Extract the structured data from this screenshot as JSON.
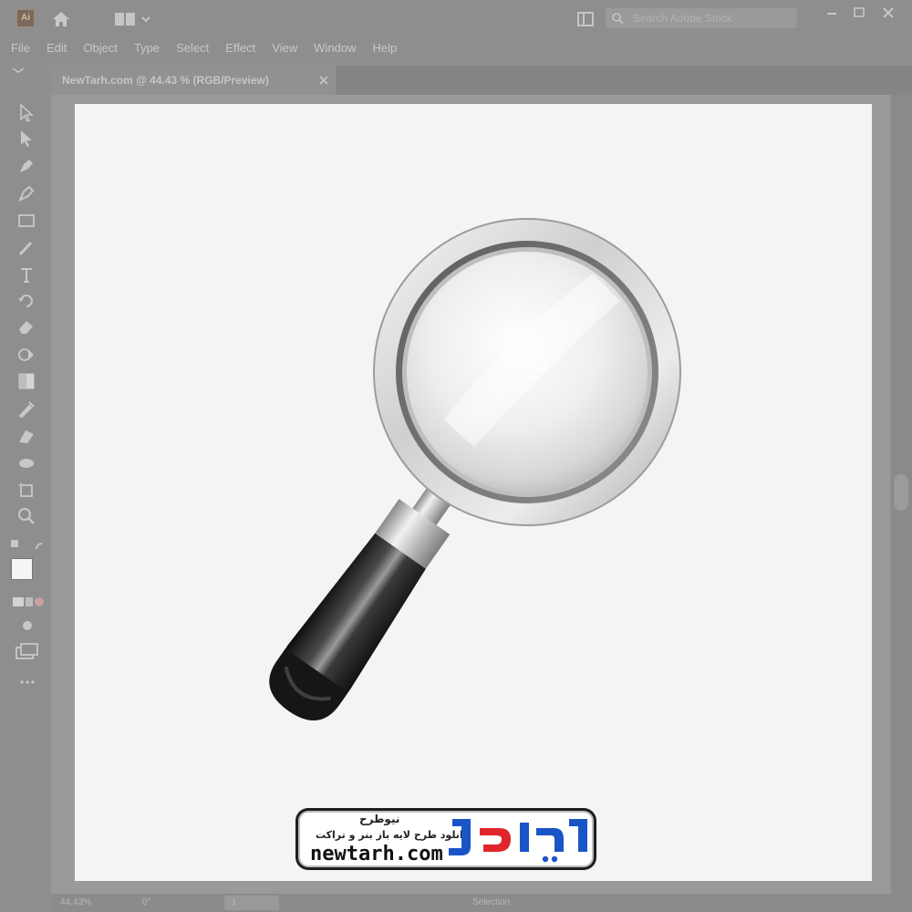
{
  "app": {
    "logo_text": "Ai",
    "search_placeholder": "Search Adobe Stock"
  },
  "menu": [
    "File",
    "Edit",
    "Object",
    "Type",
    "Select",
    "Effect",
    "View",
    "Window",
    "Help"
  ],
  "document_tab": {
    "title": "NewTarh.com @ 44.43 % (RGB/Preview)"
  },
  "toolbar": {
    "tools": [
      "selection-tool",
      "direct-selection-tool",
      "pen-tool",
      "curvature-tool",
      "rectangle-tool",
      "paintbrush-tool",
      "type-tool",
      "rotate-tool",
      "eraser-tool",
      "shape-builder-tool",
      "gradient-tool",
      "eyedropper-tool",
      "blend-tool",
      "symbol-sprayer-tool",
      "artboard-tool",
      "zoom-tool"
    ]
  },
  "status": {
    "zoom": "44.43%",
    "rotation": "0°",
    "artboard_number": "1",
    "tool_name": "Selection"
  },
  "watermark": {
    "brand_fa": "نیوطرح",
    "tagline_fa": "دانلود طرح لایه باز بنر و تراکت",
    "url": "newtarh.com",
    "logo_fa": "نیوطرح",
    "logo_colors": {
      "main": "#1a55c8",
      "accent": "#e0262a"
    }
  }
}
